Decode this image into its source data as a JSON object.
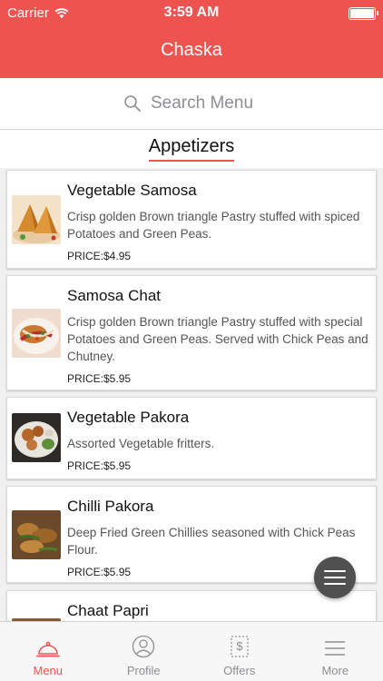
{
  "status": {
    "carrier": "Carrier",
    "time": "3:59 AM"
  },
  "header": {
    "title": "Chaska"
  },
  "search": {
    "placeholder": "Search Menu"
  },
  "section": {
    "title": "Appetizers"
  },
  "items": [
    {
      "name": "Vegetable Samosa",
      "desc": "Crisp golden Brown triangle Pastry stuffed with spiced Potatoes and Green Peas.",
      "price": "PRICE:$4.95"
    },
    {
      "name": "Samosa Chat",
      "desc": "Crisp golden Brown triangle Pastry stuffed with special Potatoes and Green Peas. Served with Chick Peas and Chutney.",
      "price": "PRICE:$5.95"
    },
    {
      "name": "Vegetable Pakora",
      "desc": "Assorted Vegetable fritters.",
      "price": "PRICE:$5.95"
    },
    {
      "name": "Chilli Pakora",
      "desc": "Deep Fried Green Chillies seasoned with Chick Peas Flour.",
      "price": "PRICE:$5.95"
    },
    {
      "name": "Chaat Papri",
      "desc": "",
      "price": ""
    }
  ],
  "tabs": [
    {
      "label": "Menu",
      "icon": "cloche-icon"
    },
    {
      "label": "Profile",
      "icon": "profile-icon"
    },
    {
      "label": "Offers",
      "icon": "offers-icon"
    },
    {
      "label": "More",
      "icon": "more-icon"
    }
  ],
  "colors": {
    "accent": "#ef5350",
    "fab": "#505050"
  }
}
